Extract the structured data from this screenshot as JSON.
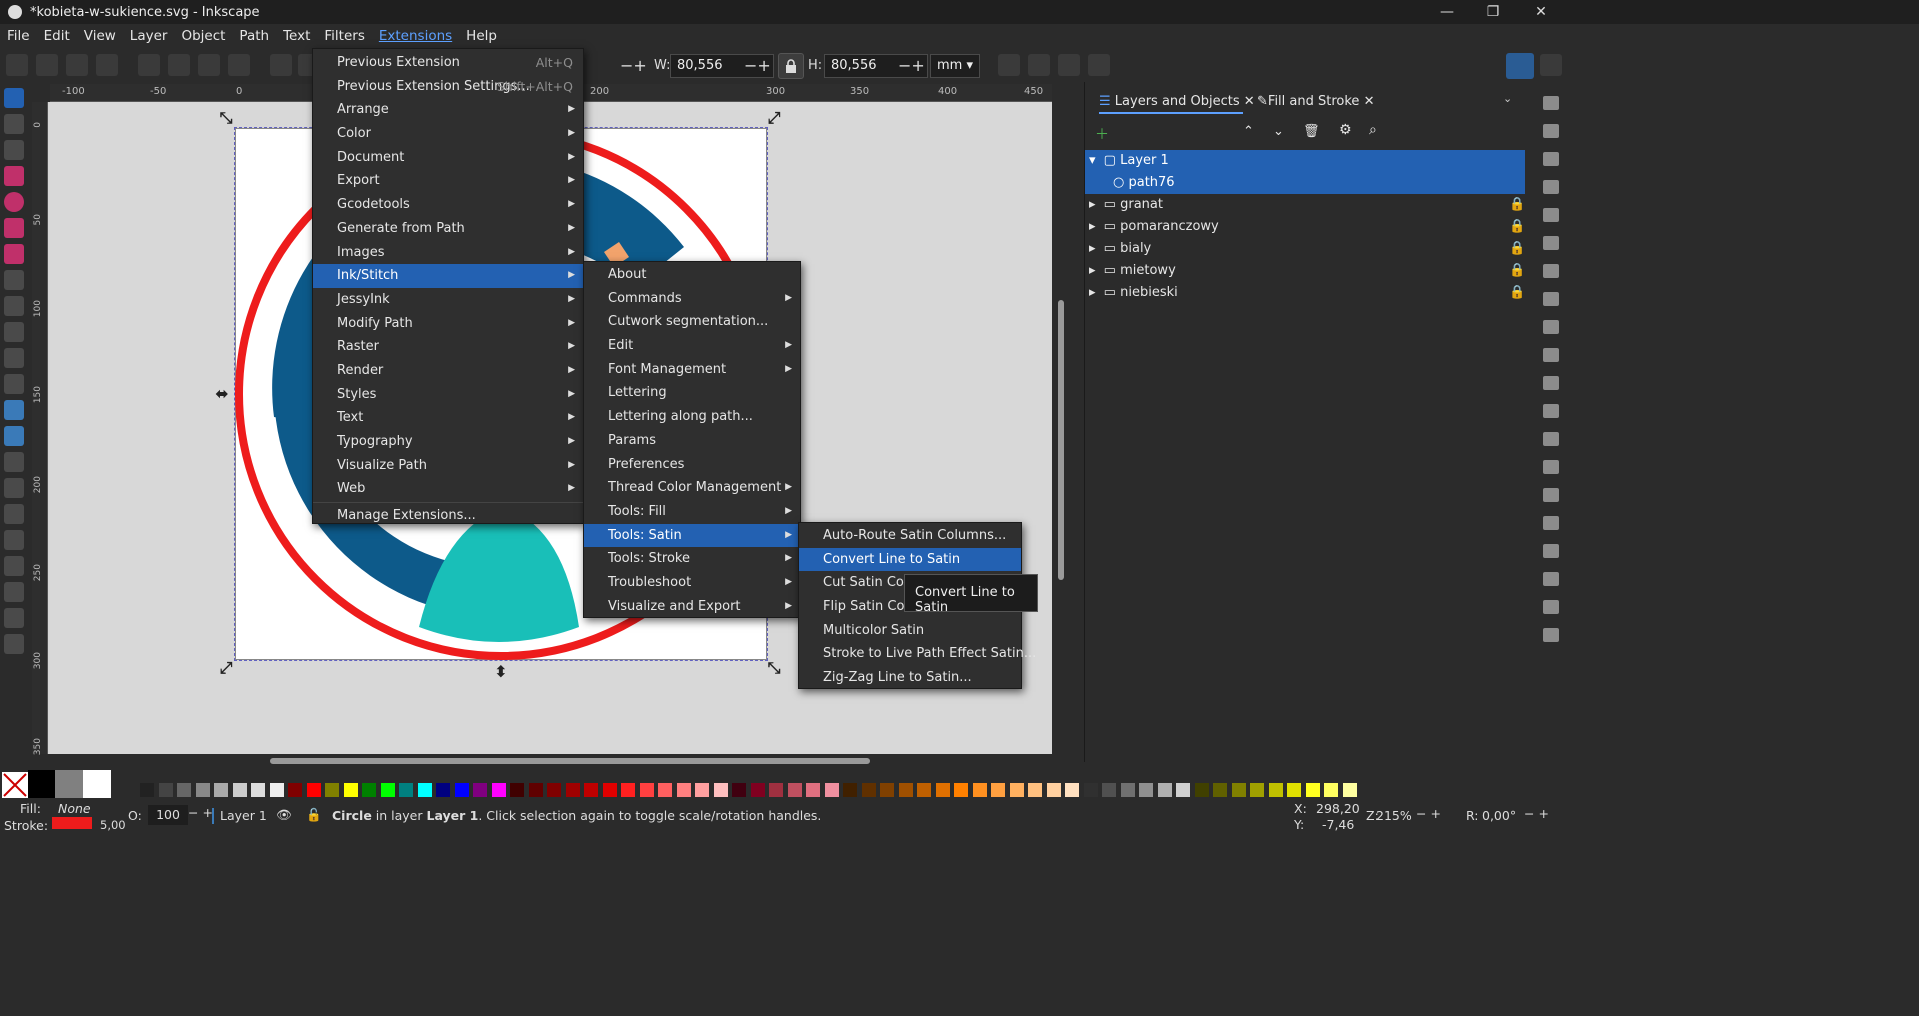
{
  "window": {
    "title": "*kobieta-w-sukience.svg - Inkscape",
    "minimize": "—",
    "maximize": "❐",
    "close": "✕"
  },
  "menubar": [
    "File",
    "Edit",
    "View",
    "Layer",
    "Object",
    "Path",
    "Text",
    "Filters",
    "Extensions",
    "Help"
  ],
  "toolbar": {
    "w_label": "W:",
    "w_value": "80,556",
    "h_label": "H:",
    "h_value": "80,556",
    "unit": "mm"
  },
  "ruler": {
    "h_ticks": [
      "-100",
      "-50",
      "0",
      "200",
      "300",
      "350",
      "400",
      "450"
    ],
    "v_ticks": [
      "0",
      "50",
      "100",
      "150",
      "200",
      "250",
      "300",
      "350"
    ]
  },
  "extensions_menu": {
    "items": [
      {
        "label": "Previous Extension",
        "accel": "Alt+Q"
      },
      {
        "label": "Previous Extension Settings...",
        "accel": "Shift+Alt+Q"
      },
      {
        "label": "Arrange",
        "sub": true
      },
      {
        "label": "Color",
        "sub": true
      },
      {
        "label": "Document",
        "sub": true
      },
      {
        "label": "Export",
        "sub": true
      },
      {
        "label": "Gcodetools",
        "sub": true
      },
      {
        "label": "Generate from Path",
        "sub": true
      },
      {
        "label": "Images",
        "sub": true
      },
      {
        "label": "Ink/Stitch",
        "sub": true,
        "highlighted": true
      },
      {
        "label": "JessyInk",
        "sub": true
      },
      {
        "label": "Modify Path",
        "sub": true
      },
      {
        "label": "Raster",
        "sub": true
      },
      {
        "label": "Render",
        "sub": true
      },
      {
        "label": "Styles",
        "sub": true
      },
      {
        "label": "Text",
        "sub": true
      },
      {
        "label": "Typography",
        "sub": true
      },
      {
        "label": "Visualize Path",
        "sub": true
      },
      {
        "label": "Web",
        "sub": true
      },
      {
        "label": "Manage Extensions...",
        "sub": false
      }
    ]
  },
  "inkstitch_menu": {
    "items": [
      {
        "label": "About"
      },
      {
        "label": "Commands",
        "sub": true
      },
      {
        "label": "Cutwork segmentation..."
      },
      {
        "label": "Edit",
        "sub": true
      },
      {
        "label": "Font Management",
        "sub": true
      },
      {
        "label": "Lettering"
      },
      {
        "label": "Lettering along path..."
      },
      {
        "label": "Params"
      },
      {
        "label": "Preferences"
      },
      {
        "label": "Thread Color Management",
        "sub": true
      },
      {
        "label": "Tools: Fill",
        "sub": true
      },
      {
        "label": "Tools: Satin",
        "sub": true,
        "highlighted": true
      },
      {
        "label": "Tools: Stroke",
        "sub": true
      },
      {
        "label": "Troubleshoot",
        "sub": true
      },
      {
        "label": "Visualize and Export",
        "sub": true
      }
    ]
  },
  "satin_menu": {
    "items": [
      {
        "label": "Auto-Route Satin Columns..."
      },
      {
        "label": "Convert Line to Satin",
        "highlighted": true
      },
      {
        "label": "Cut Satin Column"
      },
      {
        "label": "Flip Satin Column Rails"
      },
      {
        "label": "Multicolor Satin"
      },
      {
        "label": "Stroke to Live Path Effect Satin..."
      },
      {
        "label": "Zig-Zag Line to Satin..."
      }
    ]
  },
  "tooltip": "Convert Line to Satin",
  "panel": {
    "tab1": "Layers and Objects",
    "tab2": "Fill and Stroke",
    "rows": [
      {
        "label": "Layer 1",
        "selected": true,
        "expanded": true
      },
      {
        "label": "path76",
        "selected": true,
        "child": true
      },
      {
        "label": "granat",
        "locked": true
      },
      {
        "label": "pomaranczowy",
        "locked": true
      },
      {
        "label": "bialy",
        "locked": true
      },
      {
        "label": "mietowy",
        "locked": true
      },
      {
        "label": "niebieski",
        "locked": true
      }
    ]
  },
  "status": {
    "fill_label": "Fill:",
    "fill_value": "None",
    "stroke_label": "Stroke:",
    "stroke_width": "5,00",
    "opacity_label": "O:",
    "opacity_value": "100",
    "layer": "Layer 1",
    "msg_bold": "Circle",
    "msg_1": " in layer ",
    "msg_layer": "Layer 1",
    "msg_2": ". Click selection again to toggle scale/rotation handles.",
    "x_label": "X:",
    "x_value": "298,20",
    "y_label": "Y:",
    "y_value": "-7,46",
    "zoom": "215%",
    "rot_label": "R:",
    "rot_value": "0,00°"
  },
  "colors": {
    "accent": "#2361b2",
    "circle_red": "#ee1c1c",
    "navy": "#0d5a8a",
    "teal": "#19bfb8",
    "orange": "#f2a36c"
  }
}
